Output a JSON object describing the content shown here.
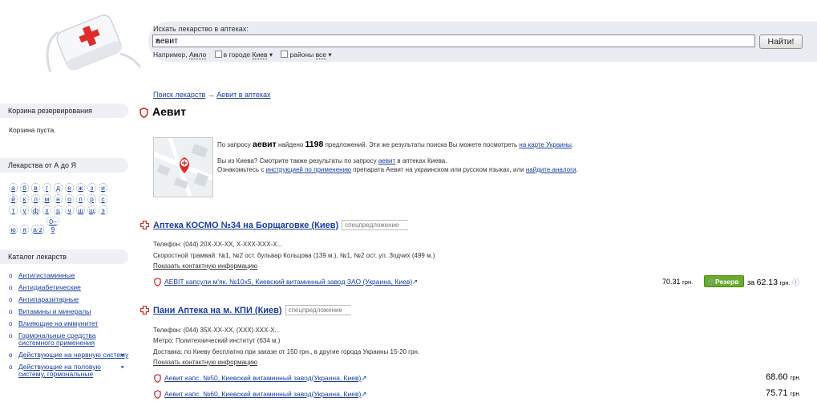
{
  "search": {
    "label": "Искать лекарство в аптеках:",
    "value": "аевит",
    "button": "Найти!",
    "example_prefix": "Например,",
    "example_link": "Амло",
    "city_label": "в городе",
    "city_value": "Киев",
    "districts_label": "районы",
    "districts_value": "все"
  },
  "sidebar": {
    "cart_title": "Корзина резервирования",
    "cart_empty": "Корзина пуста.",
    "az_title": "Лекарства от А до Я",
    "letters": [
      "а",
      "б",
      "в",
      "г",
      "д",
      "е",
      "ж",
      "з",
      "и",
      "й",
      "к",
      "л",
      "м",
      "н",
      "о",
      "п",
      "р",
      "с",
      "т",
      "у",
      "ф",
      "х",
      "ц",
      "ч",
      "ш",
      "щ",
      "э",
      "ю",
      "я",
      "a-z",
      "0–9"
    ],
    "catalog_title": "Каталог лекарств",
    "catalog": [
      {
        "label": "Антигистаминные",
        "arrow": ""
      },
      {
        "label": "Антидиабетические",
        "arrow": ""
      },
      {
        "label": "Антипаразитарные",
        "arrow": ""
      },
      {
        "label": "Витамины и минералы",
        "arrow": ""
      },
      {
        "label": "Влияющие на иммунитет",
        "arrow": ""
      },
      {
        "label": "Гормональные средства системного применения",
        "arrow": ""
      },
      {
        "label": "Действующие на нервную систему",
        "arrow": "▸"
      },
      {
        "label": "Действующие на половую систему, гормональные",
        "arrow": "▸"
      }
    ]
  },
  "breadcrumb": {
    "root": "Поиск лекарств",
    "sep": "→",
    "current": "Аевит в аптеках"
  },
  "page_title": "Аевит",
  "info": {
    "pre": "По запросу",
    "query": "аевит",
    "mid": "найдено",
    "count": "1198",
    "post": "предложений. Эти же результаты поиска Вы можете посмотреть",
    "map_link": "на карте Украины",
    "line2_pre": "Вы из Киева? Смотрите также результаты по запросу",
    "line2_link": "аевит",
    "line2_post": "в аптеках Киева.",
    "line3_pre": "Ознакомьтесь с",
    "line3_link1": "инструкцией по применению",
    "line3_mid": "препарата Аевит на украинском или русском языках, или",
    "line3_link2": "найдите аналоги",
    "line3_end": "."
  },
  "pharmacies": [
    {
      "name": "Аптека КОСМО №34 на Борщаговке (Киев)",
      "badge": "спецпредложение",
      "phone": "Телефон: (044) 20X-XX-XX, X-XXX-XXX-X...",
      "transport": "Скоростной трамвай: №1, №2 ост. бульвар Кольцова (139 м.), №1, №2 ост. ул. Зодчих (499 м.)",
      "contact": "Показать контактную информацию",
      "products": [
        {
          "name": "АЕВІТ капсули м'як. №10х5, Киевский витаминный завод ЗАО (Украина, Киев)",
          "price": "70.31",
          "currency": "грн.",
          "reserve": "Резерв",
          "for": "за",
          "reserve_price": "62.13",
          "reserve_currency": "грн.",
          "info": "ⓘ"
        }
      ]
    },
    {
      "name": "Пани Аптека на м. КПИ (Киев)",
      "badge": "спецпредложение",
      "phone": "Телефон: (044) 35X-XX-XX, (XXX) XXX-X...",
      "metro": "Метро: Политехнический институт (634 м.)",
      "delivery": "Доставка: по Киеву бесплатно при заказе от 150 грн., в другие города Украины 15-20 грн.",
      "contact": "Показать контактную информацию",
      "products": [
        {
          "name": "Аевит капс. №50, Киевский витаминный завод(Украина, Киев)",
          "price": "68.60",
          "currency": "грн."
        },
        {
          "name": "Аевит капс. №60, Киевский витаминный завод(Украина, Киев)",
          "price": "75.71",
          "currency": "грн."
        }
      ]
    }
  ],
  "colors": {
    "link": "#1a3d9e",
    "accent_red": "#d32a2a",
    "reserve_green": "#6aaa2c"
  }
}
